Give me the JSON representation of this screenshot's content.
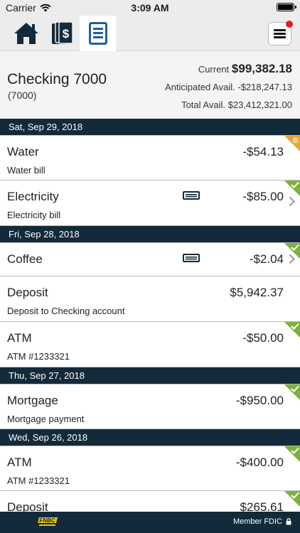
{
  "status_bar": {
    "carrier": "Carrier",
    "time": "3:09 AM"
  },
  "nav": {
    "tabs": [
      {
        "icon": "home-icon"
      },
      {
        "icon": "money-icon"
      },
      {
        "icon": "register-icon",
        "selected": true
      }
    ],
    "menu_icon": "hamburger-menu-icon",
    "notification": true
  },
  "account": {
    "name": "Checking 7000",
    "number": "(7000)",
    "current_label": "Current",
    "current_value": "$99,382.18",
    "anticipated_label": "Anticipated Avail.",
    "anticipated_value": "-$218,247.13",
    "total_label": "Total Avail.",
    "total_value": "$23,412,321.00"
  },
  "groups": [
    {
      "date": "Sat, Sep 29, 2018",
      "transactions": [
        {
          "description": "Water",
          "memo": "Water bill",
          "amount": "-$54.13",
          "status": "pending"
        },
        {
          "description": "Electricity",
          "memo": "Electricity bill",
          "amount": "-$85.00",
          "status": "cleared",
          "has_card": true,
          "has_chevron": true
        }
      ]
    },
    {
      "date": "Fri, Sep 28, 2018",
      "transactions": [
        {
          "description": "Coffee",
          "memo": "",
          "amount": "-$2.04",
          "status": "cleared",
          "has_card": true,
          "has_chevron": true
        },
        {
          "description": "Deposit",
          "memo": "Deposit to Checking account",
          "amount": "$5,942.37",
          "status": "none"
        },
        {
          "description": "ATM",
          "memo": "ATM #1233321",
          "amount": "-$50.00",
          "status": "cleared"
        }
      ]
    },
    {
      "date": "Thu, Sep 27, 2018",
      "transactions": [
        {
          "description": "Mortgage",
          "memo": "Mortgage payment",
          "amount": "-$950.00",
          "status": "cleared"
        }
      ]
    },
    {
      "date": "Wed, Sep 26, 2018",
      "transactions": [
        {
          "description": "ATM",
          "memo": "ATM #1233321",
          "amount": "-$400.00",
          "status": "cleared"
        },
        {
          "description": "Deposit",
          "memo": "",
          "amount": "$265.61",
          "status": "cleared"
        }
      ]
    }
  ],
  "footer": {
    "logo_text": "FNBC",
    "member_text": "Member FDIC"
  },
  "colors": {
    "header_navy": "#132a3a",
    "accent_blue": "#1f5f9e",
    "cleared_green": "#7bb13c",
    "pending_orange": "#e8a33a",
    "logo_gold": "#e8c21a"
  }
}
